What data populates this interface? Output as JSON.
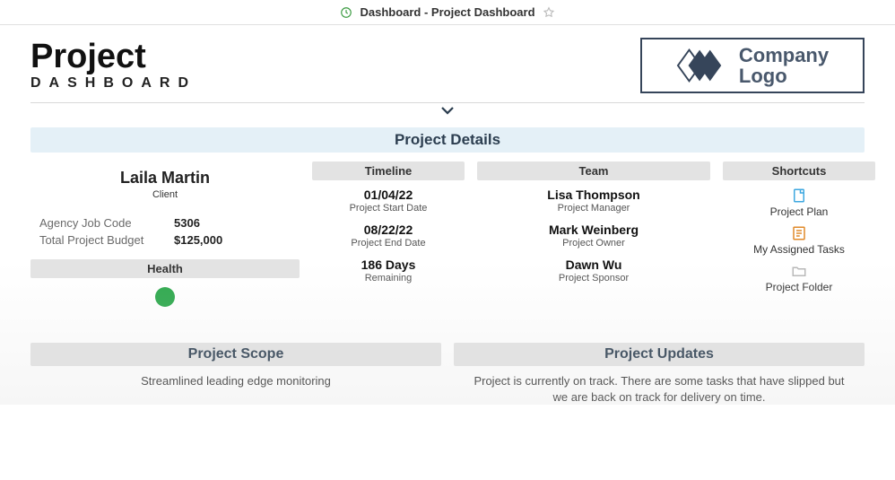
{
  "topbar": {
    "title": "Dashboard - Project Dashboard"
  },
  "header": {
    "title": "Project",
    "subtitle": "DASHBOARD",
    "logo_line1": "Company",
    "logo_line2": "Logo"
  },
  "banner": {
    "project_details": "Project Details"
  },
  "client": {
    "name": "Laila Martin",
    "role": "Client",
    "fields": {
      "job_code_label": "Agency Job Code",
      "job_code_value": "5306",
      "budget_label": "Total Project Budget",
      "budget_value": "$125,000"
    },
    "health_header": "Health",
    "health_status": "green"
  },
  "timeline": {
    "header": "Timeline",
    "start_value": "01/04/22",
    "start_label": "Project Start Date",
    "end_value": "08/22/22",
    "end_label": "Project End Date",
    "remaining_value": "186 Days",
    "remaining_label": "Remaining"
  },
  "team": {
    "header": "Team",
    "members": [
      {
        "name": "Lisa Thompson",
        "role": "Project Manager"
      },
      {
        "name": "Mark Weinberg",
        "role": "Project Owner"
      },
      {
        "name": "Dawn Wu",
        "role": "Project Sponsor"
      }
    ]
  },
  "shortcuts": {
    "header": "Shortcuts",
    "items": [
      {
        "label": "Project Plan",
        "icon": "document-icon",
        "color": "#3fa8e0"
      },
      {
        "label": "My Assigned Tasks",
        "icon": "checklist-icon",
        "color": "#e08a2a"
      },
      {
        "label": "Project Folder",
        "icon": "folder-icon",
        "color": "#c9c9c9"
      }
    ]
  },
  "bottom": {
    "scope_header": "Project Scope",
    "scope_body": "Streamlined leading edge monitoring",
    "updates_header": "Project Updates",
    "updates_body": "Project is currently on track. There are some tasks that have slipped but we are back on track for delivery on time."
  }
}
